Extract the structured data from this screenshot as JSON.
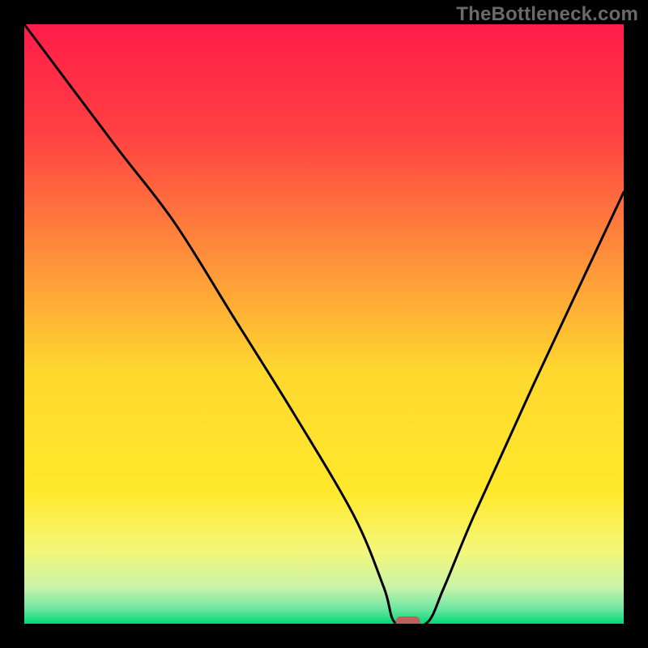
{
  "watermark": "TheBottleneck.com",
  "chart_data": {
    "type": "line",
    "title": "",
    "xlabel": "",
    "ylabel": "",
    "xlim": [
      0,
      100
    ],
    "ylim": [
      0,
      100
    ],
    "x": [
      0,
      15,
      25,
      35,
      45,
      55,
      60,
      62,
      67,
      70,
      75,
      85,
      100
    ],
    "values": [
      100,
      80,
      67,
      51,
      35,
      18,
      6,
      0,
      0,
      6,
      18,
      40,
      72
    ],
    "marker": {
      "x": 64,
      "y": 0
    },
    "grid": false,
    "legend": false,
    "background_gradient": {
      "stops": [
        {
          "offset": 0.0,
          "color": "#ff1c4a"
        },
        {
          "offset": 0.18,
          "color": "#ff4042"
        },
        {
          "offset": 0.4,
          "color": "#ff943a"
        },
        {
          "offset": 0.58,
          "color": "#ffd82e"
        },
        {
          "offset": 0.78,
          "color": "#ffe92c"
        },
        {
          "offset": 0.88,
          "color": "#f4f77a"
        },
        {
          "offset": 0.94,
          "color": "#c8f3a9"
        },
        {
          "offset": 0.975,
          "color": "#6fe6a2"
        },
        {
          "offset": 1.0,
          "color": "#00d977"
        }
      ]
    },
    "marker_color": "#c0605a",
    "line_color": "#000000"
  }
}
